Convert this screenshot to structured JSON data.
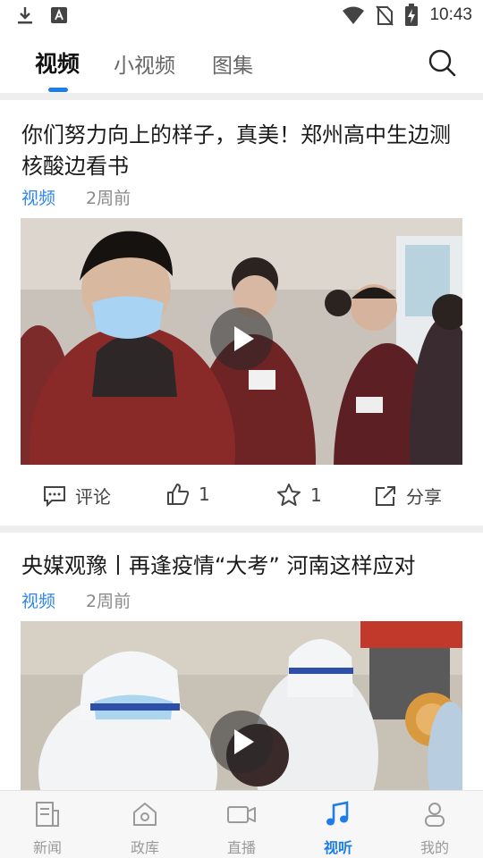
{
  "status_bar": {
    "time": "10:43"
  },
  "top_tabs": [
    {
      "label": "视频",
      "active": true
    },
    {
      "label": "小视频",
      "active": false
    },
    {
      "label": "图集",
      "active": false
    }
  ],
  "feed": [
    {
      "title": "你们努力向上的样子，真美！郑州高中生边测核酸边看书",
      "category": "视频",
      "time": "2周前",
      "actions": {
        "comment_label": "评论",
        "like_count": "1",
        "fav_count": "1",
        "share_label": "分享"
      }
    },
    {
      "title": "央媒观豫丨再逢疫情“大考” 河南这样应对",
      "category": "视频",
      "time": "2周前"
    }
  ],
  "bottom_nav": [
    {
      "label": "新闻",
      "icon": "news-icon",
      "active": false
    },
    {
      "label": "政库",
      "icon": "home-icon",
      "active": false
    },
    {
      "label": "直播",
      "icon": "camera-icon",
      "active": false
    },
    {
      "label": "视听",
      "icon": "music-note-icon",
      "active": true
    },
    {
      "label": "我的",
      "icon": "profile-icon",
      "active": false
    }
  ],
  "colors": {
    "accent": "#1f7de6",
    "category": "#2f86e6",
    "muted": "#8a8a8a"
  }
}
